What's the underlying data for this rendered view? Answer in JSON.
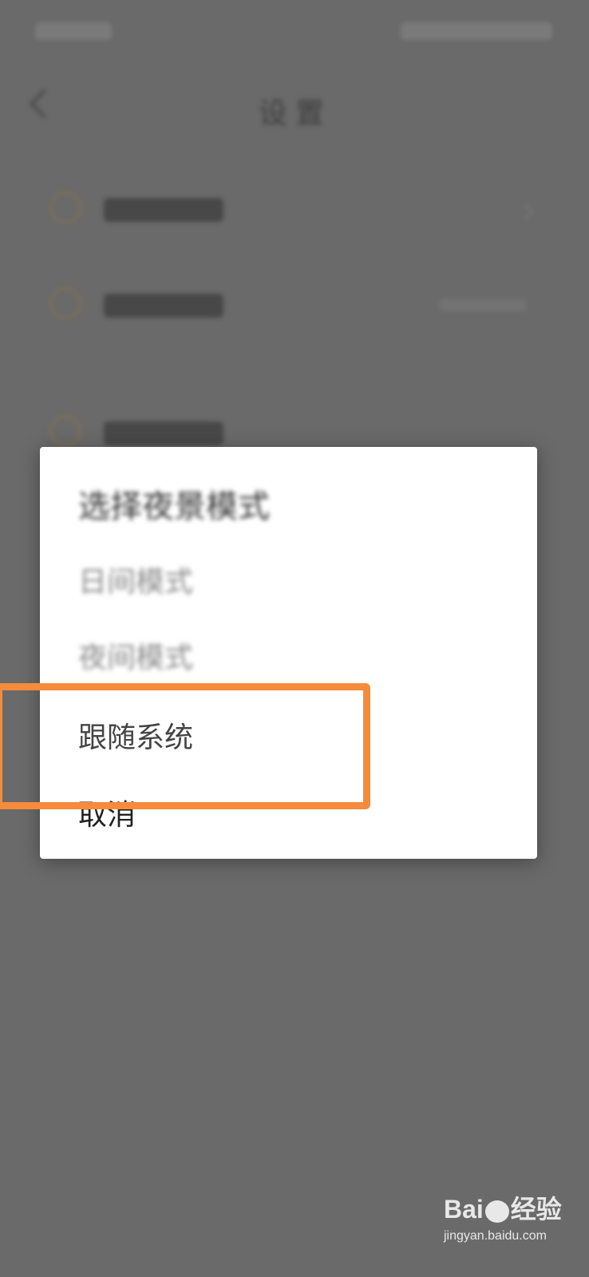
{
  "dialog": {
    "title": "选择夜景模式",
    "options": {
      "day": "日间模式",
      "night": "夜间模式",
      "follow_system": "跟随系统",
      "cancel": "取消"
    }
  },
  "watermark": {
    "brand_left": "Bai",
    "brand_right": "经验",
    "site": "jingyan.baidu.com"
  },
  "colors": {
    "highlight": "#f68b3b",
    "overlay": "#6a6a6a",
    "dialog_bg": "#ffffff"
  }
}
